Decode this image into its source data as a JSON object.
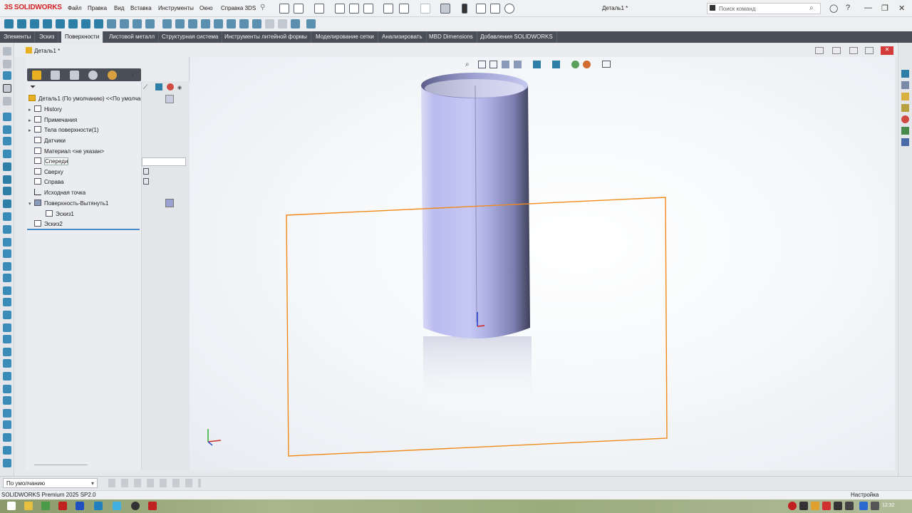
{
  "app": {
    "brand": "SOLIDWORKS",
    "document_title": "Деталь1 *",
    "status": "SOLIDWORKS Premium 2025 SP2.0",
    "settings_label": "Настройка",
    "clock": "12:32"
  },
  "menu": [
    "Файл",
    "Правка",
    "Вид",
    "Вставка",
    "Инструменты",
    "Окно",
    "Справка 3DS"
  ],
  "search": {
    "placeholder": "Поиск команд"
  },
  "tabs": [
    {
      "label": "Элементы",
      "active": false
    },
    {
      "label": "Эскиз",
      "active": false
    },
    {
      "label": "Поверхности",
      "active": true
    },
    {
      "label": "Листовой металл",
      "active": false
    },
    {
      "label": "Структурная система",
      "active": false
    },
    {
      "label": "Инструменты литейной формы",
      "active": false
    },
    {
      "label": "Моделирование сетки",
      "active": false
    },
    {
      "label": "Анализировать",
      "active": false
    },
    {
      "label": "MBD Dimensions",
      "active": false
    },
    {
      "label": "Добавления SOLIDWORKS",
      "active": false
    }
  ],
  "document_tab": "Деталь1 *",
  "tree": {
    "root": "Деталь1 (По умолчанию) <<По умолча",
    "items": [
      {
        "label": "History",
        "expandable": true
      },
      {
        "label": "Примечания",
        "expandable": true
      },
      {
        "label": "Тела поверхности(1)",
        "expandable": true
      },
      {
        "label": "Датчики",
        "expandable": false
      },
      {
        "label": "Материал <не указан>",
        "expandable": false
      },
      {
        "label": "Спереди",
        "expandable": false,
        "selected": true
      },
      {
        "label": "Сверху",
        "expandable": false
      },
      {
        "label": "Справа",
        "expandable": false
      },
      {
        "label": "Исходная точка",
        "expandable": false
      },
      {
        "label": "Поверхность-Вытянуть1",
        "expandable": true,
        "expanded": true
      },
      {
        "label": "Эскиз1",
        "expandable": false,
        "child": true
      },
      {
        "label": "Эскиз2",
        "expandable": false
      }
    ]
  },
  "config": {
    "value": "По умолчанию"
  },
  "colors": {
    "accent": "#d42222",
    "plane": "#f08a1a",
    "cylinder": "#b8bcf0",
    "tabbar": "#4a4f57"
  },
  "icons": [
    "home-icon",
    "new-icon",
    "open-icon",
    "save-icon",
    "print-icon",
    "undo-icon",
    "select-icon",
    "options-icon",
    "search-icon",
    "help-icon"
  ]
}
